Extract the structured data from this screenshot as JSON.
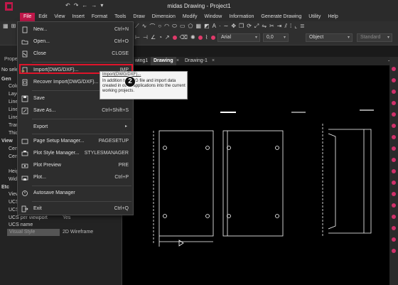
{
  "window": {
    "title": "midas Drawing - Project1"
  },
  "menubar": [
    {
      "label": "File",
      "active": true
    },
    {
      "label": "Edit"
    },
    {
      "label": "View"
    },
    {
      "label": "Insert"
    },
    {
      "label": "Format"
    },
    {
      "label": "Tools"
    },
    {
      "label": "Draw"
    },
    {
      "label": "Dimension"
    },
    {
      "label": "Modify"
    },
    {
      "label": "Window"
    },
    {
      "label": "Information"
    },
    {
      "label": "Generate Drawing"
    },
    {
      "label": "Utility"
    },
    {
      "label": "Help"
    }
  ],
  "toolbar": {
    "font": "Arial",
    "size": "0,0",
    "object_combo": "Object",
    "standard_combo": "Standard"
  },
  "file_menu": {
    "items": [
      {
        "label": "New...",
        "shortcut": "Ctrl+N",
        "icon": "new-file-icon"
      },
      {
        "label": "Open...",
        "shortcut": "Ctrl+O",
        "icon": "open-folder-icon"
      },
      {
        "label": "Close",
        "shortcut": "CLOSE",
        "icon": "close-file-icon"
      },
      {
        "label": "Import(DWG/DXF)...",
        "shortcut": "IMP",
        "icon": "import-icon"
      },
      {
        "label": "Recover Import(DWG/DXF)...",
        "shortcut": "",
        "icon": "recover-import-icon"
      },
      {
        "label": "Save",
        "shortcut": "",
        "icon": "save-icon"
      },
      {
        "label": "Save As...",
        "shortcut": "Ctrl+Shift+S",
        "icon": "save-as-icon"
      },
      {
        "label": "Export",
        "shortcut": "",
        "icon": "export-icon"
      },
      {
        "label": "Page Setup Manager...",
        "shortcut": "PAGESETUP",
        "icon": "page-setup-icon"
      },
      {
        "label": "Plot Style Manager...",
        "shortcut": "STYLESMANAGER",
        "icon": "plot-style-icon"
      },
      {
        "label": "Plot Preview",
        "shortcut": "PRE",
        "icon": "plot-preview-icon"
      },
      {
        "label": "Plot...",
        "shortcut": "Ctrl+P",
        "icon": "plot-icon"
      },
      {
        "label": "Autosave Manager",
        "shortcut": "",
        "icon": "autosave-icon"
      },
      {
        "label": "Exit",
        "shortcut": "Ctrl+Q",
        "icon": "exit-icon"
      }
    ]
  },
  "tooltip": {
    "title": "Import(DWG/DXF)...",
    "body": "In addition to DWG file and import data created in other applications into the current working projects."
  },
  "step_badge": "2",
  "left_panel": {
    "title": "Prope",
    "no_selection": "No sele",
    "rows": [
      {
        "label": "Gen",
        "value": ""
      },
      {
        "label": "Colo",
        "value": ""
      },
      {
        "label": "Laye",
        "value": ""
      },
      {
        "label": "Line",
        "value": ""
      },
      {
        "label": "Line",
        "value": ""
      },
      {
        "label": "Line",
        "value": ""
      },
      {
        "label": "Tran",
        "value": ""
      },
      {
        "label": "Thic",
        "value": ""
      },
      {
        "label": "View",
        "value": ""
      },
      {
        "label": "Cent",
        "value": ""
      },
      {
        "label": "Cent",
        "value": ""
      },
      {
        "label": "Heig",
        "value": ""
      },
      {
        "label": "Widt",
        "value": ""
      },
      {
        "label": "Etc",
        "value": ""
      },
      {
        "label": "View",
        "value": ""
      },
      {
        "label": "UCS",
        "value": ""
      },
      {
        "label": "UCS",
        "value": ""
      },
      {
        "label": "UCS per viewport",
        "value": "Yes"
      },
      {
        "label": "UCS name",
        "value": ""
      }
    ],
    "visual_style_label": "Visual Style",
    "visual_style_value": "2D Wireframe"
  },
  "doc_tabs": [
    {
      "label": "wing1",
      "active": false
    },
    {
      "label": "Drawing",
      "active": true
    },
    {
      "label": "Drawing-1",
      "active": false
    }
  ],
  "colors": {
    "accent": "#c0184a",
    "highlight": "#e0142a",
    "canvas": "#000000"
  }
}
